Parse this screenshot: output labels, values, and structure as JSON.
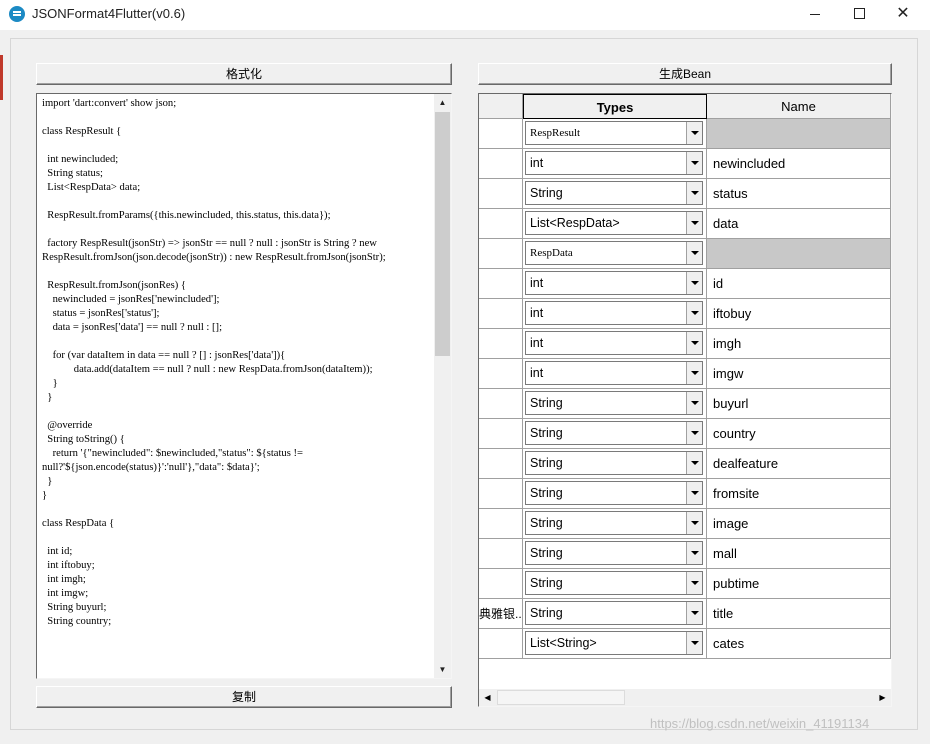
{
  "window": {
    "title": "JSONFormat4Flutter(v0.6)",
    "controls": {
      "minimize": "",
      "maximize": "",
      "close": "✕"
    }
  },
  "buttons": {
    "format": "格式化",
    "copy": "复制",
    "generate": "生成Bean"
  },
  "code": {
    "text": "import 'dart:convert' show json;\n\nclass RespResult {\n\n  int newincluded;\n  String status;\n  List<RespData> data;\n\n  RespResult.fromParams({this.newincluded, this.status, this.data});\n\n  factory RespResult(jsonStr) => jsonStr == null ? null : jsonStr is String ? new RespResult.fromJson(json.decode(jsonStr)) : new RespResult.fromJson(jsonStr);\n\n  RespResult.fromJson(jsonRes) {\n    newincluded = jsonRes['newincluded'];\n    status = jsonRes['status'];\n    data = jsonRes['data'] == null ? null : [];\n\n    for (var dataItem in data == null ? [] : jsonRes['data']){\n            data.add(dataItem == null ? null : new RespData.fromJson(dataItem));\n    }\n  }\n\n  @override\n  String toString() {\n    return '{\"newincluded\": $newincluded,\"status\": ${status != null?'${json.encode(status)}':'null'},\"data\": $data}';\n  }\n}\n\nclass RespData {\n\n  int id;\n  int iftobuy;\n  int imgh;\n  int imgw;\n  String buyurl;\n  String country;"
  },
  "grid": {
    "headers": {
      "corner": "",
      "types": "Types",
      "name": "Name"
    },
    "rows": [
      {
        "row_header": "",
        "type": "RespResult",
        "name": "",
        "class_row": true
      },
      {
        "row_header": "",
        "type": "int",
        "name": "newincluded",
        "class_row": false
      },
      {
        "row_header": "",
        "type": "String",
        "name": "status",
        "class_row": false
      },
      {
        "row_header": "",
        "type": "List<RespData>",
        "name": "data",
        "class_row": false
      },
      {
        "row_header": "",
        "type": "RespData",
        "name": "",
        "class_row": true
      },
      {
        "row_header": "",
        "type": "int",
        "name": "id",
        "class_row": false
      },
      {
        "row_header": "",
        "type": "int",
        "name": "iftobuy",
        "class_row": false
      },
      {
        "row_header": "",
        "type": "int",
        "name": "imgh",
        "class_row": false
      },
      {
        "row_header": "",
        "type": "int",
        "name": "imgw",
        "class_row": false
      },
      {
        "row_header": "",
        "type": "String",
        "name": "buyurl",
        "class_row": false
      },
      {
        "row_header": "",
        "type": "String",
        "name": "country",
        "class_row": false
      },
      {
        "row_header": "",
        "type": "String",
        "name": "dealfeature",
        "class_row": false
      },
      {
        "row_header": "",
        "type": "String",
        "name": "fromsite",
        "class_row": false
      },
      {
        "row_header": "",
        "type": "String",
        "name": "image",
        "class_row": false
      },
      {
        "row_header": "",
        "type": "String",
        "name": "mall",
        "class_row": false
      },
      {
        "row_header": "",
        "type": "String",
        "name": "pubtime",
        "class_row": false
      },
      {
        "row_header": "典雅银...",
        "type": "String",
        "name": "title",
        "class_row": false
      },
      {
        "row_header": "",
        "type": "List<String>",
        "name": "cates",
        "class_row": false
      }
    ]
  },
  "watermark": "https://blog.csdn.net/weixin_41191134",
  "colors": {
    "icon": "#1c8ac4",
    "class_row_fill": "#c8c8c8"
  },
  "icons": {
    "scroll_up": "▲",
    "scroll_down": "▼",
    "scroll_left": "◀",
    "scroll_right": "▶"
  }
}
